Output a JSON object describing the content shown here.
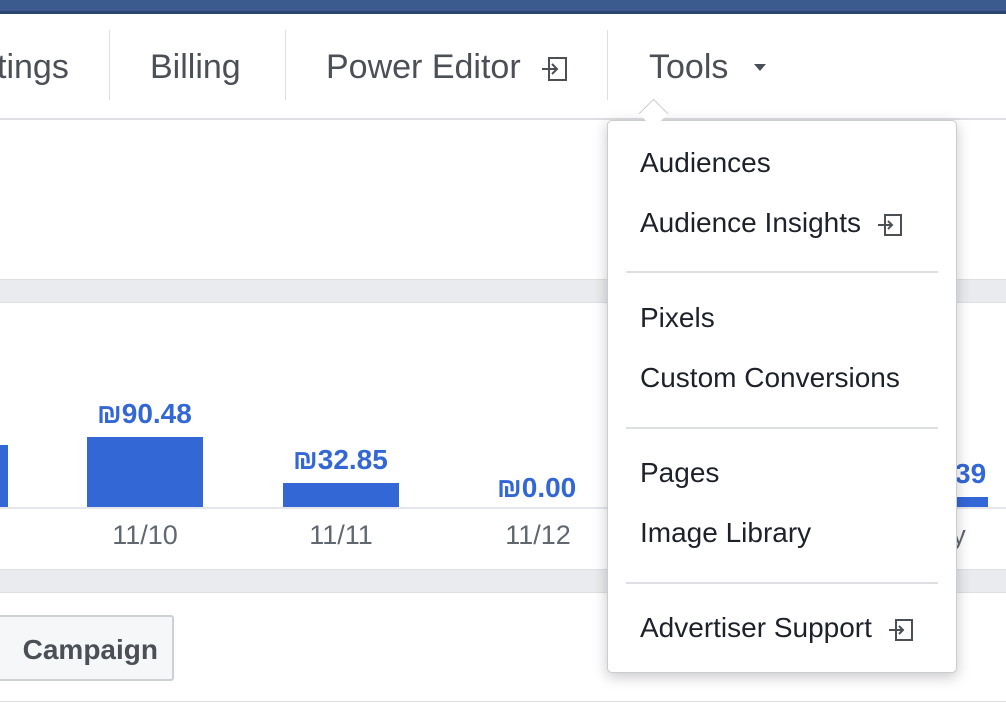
{
  "nav": {
    "items": [
      {
        "label": "tings"
      },
      {
        "label": "Billing"
      },
      {
        "label": "Power Editor"
      },
      {
        "label": "Tools"
      }
    ]
  },
  "chart_data": {
    "type": "bar",
    "categories": [
      "",
      "11/10",
      "11/11",
      "11/12",
      ""
    ],
    "values": [
      null,
      90.48,
      32.85,
      0.0,
      null
    ],
    "data_labels": [
      "",
      "₪90.48",
      "₪32.85",
      "₪0.00",
      "39"
    ],
    "tick_labels": [
      "",
      "11/10",
      "11/11",
      "11/12",
      "y"
    ],
    "bar_color": "#3367d6"
  },
  "create_button": {
    "label": "Campaign"
  },
  "dropdown": {
    "groups": [
      {
        "items": [
          {
            "label": "Audiences"
          },
          {
            "label": "Audience Insights"
          }
        ]
      },
      {
        "items": [
          {
            "label": "Pixels"
          },
          {
            "label": "Custom Conversions"
          }
        ]
      },
      {
        "items": [
          {
            "label": "Pages"
          },
          {
            "label": "Image Library"
          }
        ]
      },
      {
        "items": [
          {
            "label": "Advertiser Support"
          }
        ]
      }
    ]
  },
  "colors": {
    "topbar": "#3b5a8e",
    "accent": "#3367d6",
    "text": "#4b4f56"
  }
}
